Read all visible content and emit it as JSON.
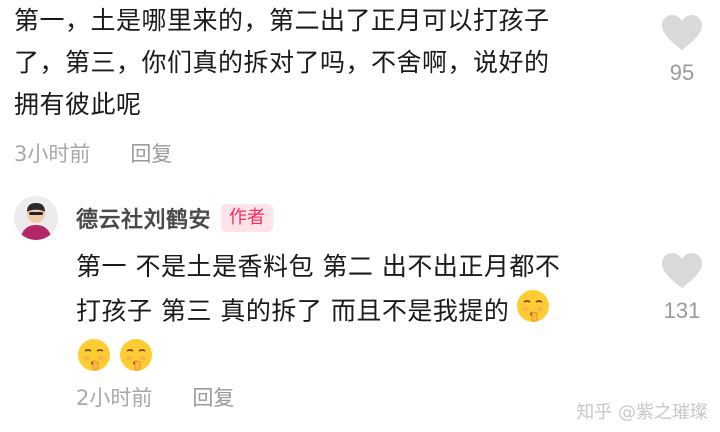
{
  "top_comment": {
    "lines": [
      "第一，土是哪里来的，第二出了正月可以打孩子",
      "了，第三，你们真的拆对了吗，不舍啊，说好的",
      "拥有彼此呢"
    ],
    "time": "3小时前",
    "reply_label": "回复",
    "likes": "95"
  },
  "reply_comment": {
    "author": "德云社刘鹤安",
    "badge": "作者",
    "lines": [
      "第一  不是土是香料包   第二  出不出正月都不",
      "打孩子   第三  真的拆了  而且不是我提的"
    ],
    "emoji_icon": "shushing-face-emoji",
    "time": "2小时前",
    "reply_label": "回复",
    "likes": "131"
  },
  "watermark": "知乎 @紫之璀璨",
  "colors": {
    "text": "#1a1a1a",
    "meta": "#a8a8a8",
    "like_icon": "#d9d9d9",
    "badge_text": "#ff2b5a",
    "badge_bg": "#ffe3ea"
  }
}
